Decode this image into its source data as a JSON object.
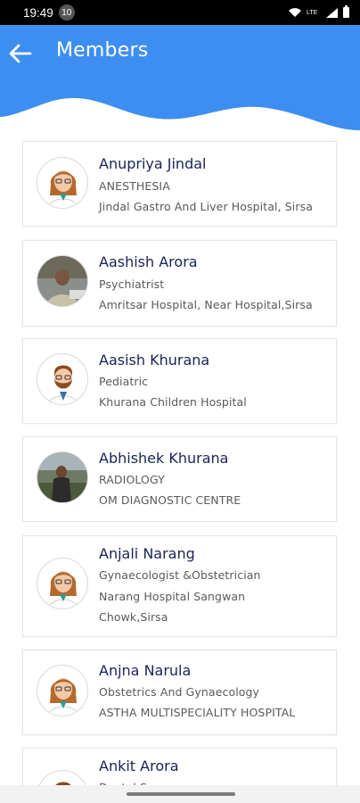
{
  "status_bar": {
    "time": "19:49",
    "badge": "10",
    "network": "LTE"
  },
  "header": {
    "title": "Members",
    "back_icon": "arrow-left-icon",
    "color": "#3d8ef0"
  },
  "members": [
    {
      "name": "Anupriya Jindal",
      "specialty": "ANESTHESIA",
      "hospital": "Jindal Gastro And Liver Hospital, Sirsa",
      "hospital_line2": "",
      "avatar": "female-doctor-icon"
    },
    {
      "name": "Aashish Arora",
      "specialty": "Psychiatrist",
      "hospital": "Amritsar Hospital, Near Hospital,Sirsa",
      "hospital_line2": "",
      "avatar": "photo-portrait"
    },
    {
      "name": "Aasish Khurana",
      "specialty": "Pediatric",
      "hospital": "Khurana Children Hospital",
      "hospital_line2": "",
      "avatar": "male-doctor-icon"
    },
    {
      "name": "Abhishek Khurana",
      "specialty": "RADIOLOGY",
      "hospital": "OM DIAGNOSTIC CENTRE",
      "hospital_line2": "",
      "avatar": "photo-portrait"
    },
    {
      "name": "Anjali Narang",
      "specialty": "Gynaecologist &Obstetrician",
      "hospital": "Narang Hospital Sangwan",
      "hospital_line2": "Chowk,Sirsa",
      "avatar": "female-doctor-icon"
    },
    {
      "name": "Anjna Narula",
      "specialty": "Obstetrics And Gynaecology",
      "hospital": "ASTHA MULTISPECIALITY HOSPITAL",
      "hospital_line2": "",
      "avatar": "female-doctor-icon"
    },
    {
      "name": "Ankit Arora",
      "specialty": "Dental Surgeon",
      "hospital": "",
      "hospital_line2": "",
      "avatar": "male-doctor-icon"
    }
  ]
}
